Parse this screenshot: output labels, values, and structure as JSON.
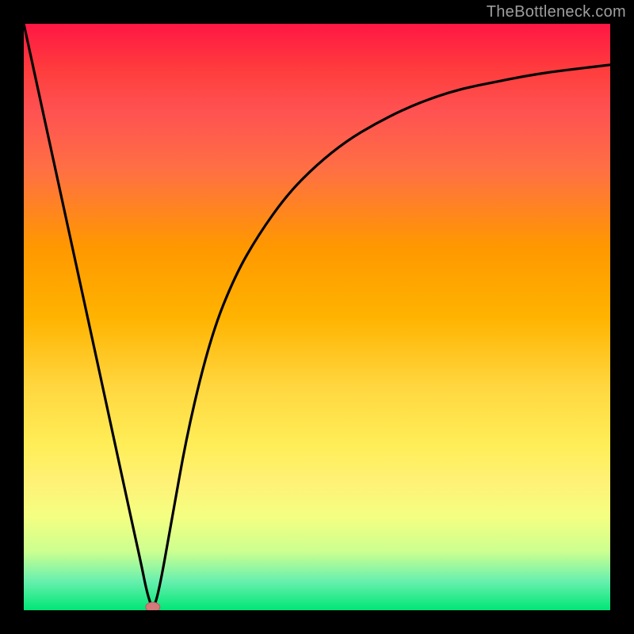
{
  "watermark": "TheBottleneck.com",
  "chart_data": {
    "type": "line",
    "title": "",
    "xlabel": "",
    "ylabel": "",
    "xlim": [
      0,
      100
    ],
    "ylim": [
      0,
      100
    ],
    "grid": false,
    "legend": false,
    "background_gradient": {
      "top": "#ff1744",
      "middle": "#ffd740",
      "bottom": "#00e676"
    },
    "series": [
      {
        "name": "bottleneck-curve",
        "color": "#000000",
        "x": [
          0,
          5,
          10,
          15,
          18,
          20,
          21,
          22,
          23,
          25,
          28,
          32,
          36,
          40,
          45,
          50,
          55,
          60,
          65,
          70,
          75,
          80,
          85,
          90,
          95,
          100
        ],
        "y": [
          100,
          77,
          54,
          31,
          17,
          8,
          3,
          0,
          3,
          14,
          31,
          47,
          57,
          64,
          71,
          76,
          80,
          83,
          85.5,
          87.5,
          89,
          90,
          91,
          91.8,
          92.4,
          93
        ]
      }
    ],
    "marker": {
      "name": "optimal-point",
      "x": 22,
      "y": 0,
      "color": "#d47a7a",
      "shape": "ellipse"
    }
  }
}
